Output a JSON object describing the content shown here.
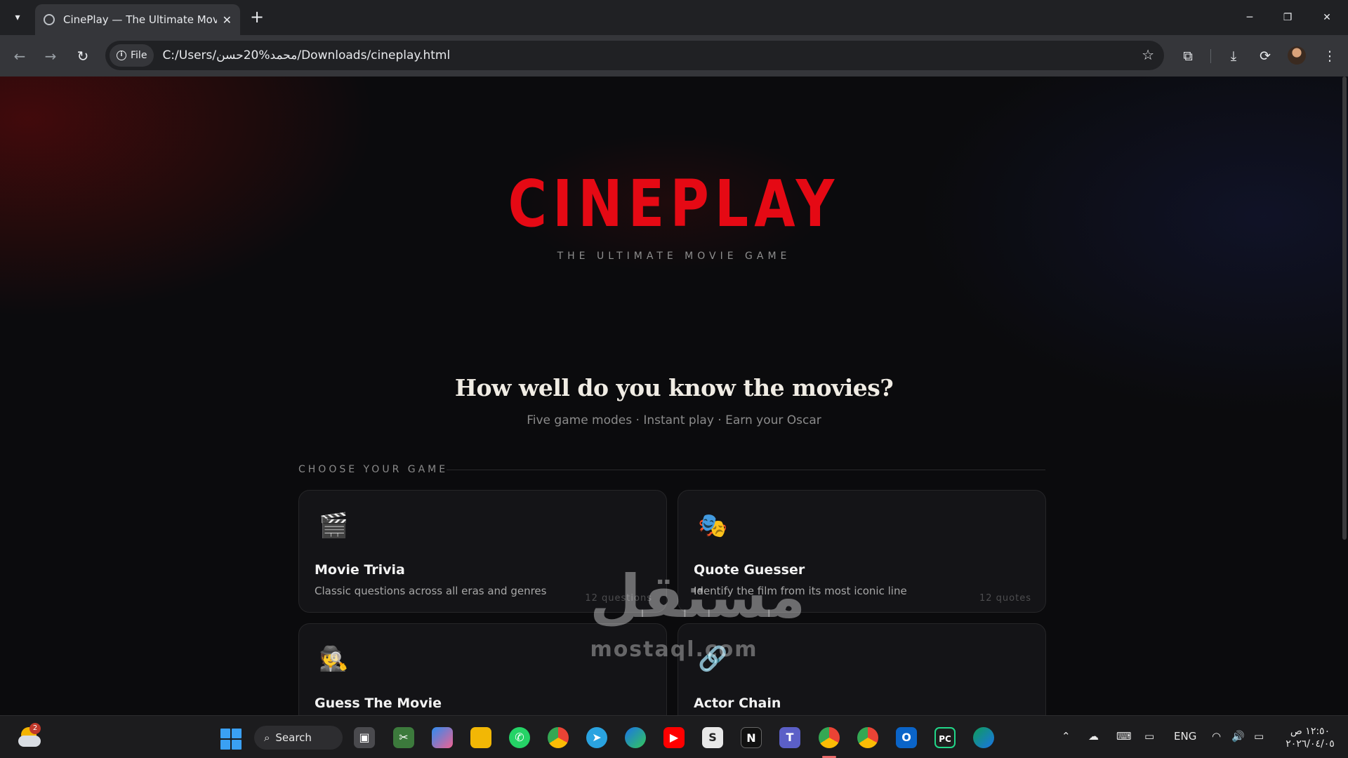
{
  "browser": {
    "tab_title": "CinePlay — The Ultimate Movie Game",
    "close_symbol": "✕",
    "new_tab_symbol": "+",
    "file_chip_label": "File",
    "url": "C:/Users/محمد%20حسن/Downloads/cineplay.html",
    "icons": [
      "tab-search-icon",
      "back-icon",
      "forward-icon",
      "reload-icon",
      "info-icon",
      "star-icon",
      "extensions-icon",
      "download-icon",
      "sync-icon",
      "profile-avatar",
      "menu-icon",
      "minimize-icon",
      "maximize-icon",
      "close-icon"
    ]
  },
  "hero": {
    "logo": "CINEPLAY",
    "tagline": "THE ULTIMATE MOVIE GAME",
    "accent_color": "#e50914"
  },
  "intro": {
    "headline": "How well do you know the movies?",
    "subline": "Five game modes · Instant play · Earn your Oscar"
  },
  "section": {
    "label": "CHOOSE YOUR GAME"
  },
  "games": [
    {
      "icon": "🎬",
      "icon_name": "clapperboard-icon",
      "title": "Movie Trivia",
      "description": "Classic questions across all eras and genres",
      "count": "12 questions"
    },
    {
      "icon": "🎭",
      "icon_name": "theater-masks-icon",
      "title": "Quote Guesser",
      "description": "Identify the film from its most iconic line",
      "count": "12 quotes"
    },
    {
      "icon": "🕵️",
      "icon_name": "detective-icon",
      "title": "Guess The Movie",
      "description": "",
      "count": ""
    },
    {
      "icon": "🔗",
      "icon_name": "link-icon",
      "title": "Actor Chain",
      "description": "",
      "count": ""
    }
  ],
  "watermark": {
    "arabic": "مستقل",
    "latin": "mostaql.com"
  },
  "taskbar": {
    "search_label": "Search",
    "weather_badge": "2",
    "language": "ENG",
    "time": "١٢:٥٠ ص",
    "date": "٢٠٢٦/٠٤/٠٥",
    "apps": [
      "task-view-icon",
      "snipping-tool-icon",
      "copilot-icon",
      "file-explorer-icon",
      "whatsapp-icon",
      "chrome-icon",
      "telegram-icon",
      "edge-icon",
      "youtube-icon",
      "sublime-icon",
      "notion-icon",
      "teams-icon",
      "chrome-active-icon",
      "chrome-profile-icon",
      "outlook-icon",
      "pycharm-icon",
      "edge-dev-icon"
    ]
  }
}
